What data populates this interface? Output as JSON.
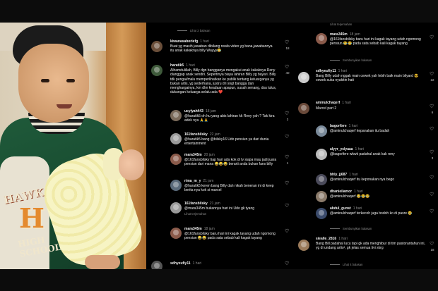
{
  "left_panel": {
    "replies_link": "Lihat 2 balasan",
    "see_translation": "Lihat terjemahan",
    "comments": [
      {
        "user": "kiwanasaboriefg",
        "time": "1 hari",
        "text": "Buat yg masih jawaban dibilang rwafa video yg bana,jawabannya itu anak kakaknya billy Wayyy😂",
        "likes": "18",
        "avatar_color": "#6b4f3a"
      },
      {
        "user": "haratik5",
        "time": "1 hari",
        "text": "Alhamdulillah, Billy dgn bangganya mengakui anak kakaknya Reny dianggap anak sendiri. Sepertinya biaya lahiran Billy yg bayari. Billy tdk pengai/malu memperlihatkan ke publik tentang keluarganya yg bukan artis, yg sederhana, justru dri sngt bangga dan menghargainya, km dlm keadaan apapun, susah senang, dsu tulus, dukungan keluarga selalu ada ❤️",
        "likes": "40",
        "avatar_color": "#3f5a3b"
      },
      {
        "user": "ucylyah443",
        "time": "18 jam",
        "text": "@haratik5 oh hu yang abis lahiran kk Reny yah ? Tak kira adek nya 🙏🙏",
        "likes": "3",
        "avatar_color": "#7a6a5a"
      },
      {
        "user": "161fansbilsky",
        "time": "22 jam",
        "text": "@haratik5 bang @bilsky16 Udo pensiun ya dari dunia entertainment",
        "likes": "",
        "avatar_color": "#9a9a9a"
      },
      {
        "user": "mara345m",
        "time": "20 jam",
        "text": "@161fansbilsky tiap hari ada kok di tv siapa mau jadi juara pensiun dari mana 😂😂😂 berarti anda bukan fans billy",
        "likes": "1",
        "avatar_color": "#8a5a4a"
      },
      {
        "user": "rima_m_y",
        "time": "21 jam",
        "text": "@haratik5 keren bang Billy dah nikah beneran ini di keep berita nya kok si marcel",
        "likes": "",
        "avatar_color": "#5a6a7a"
      },
      {
        "user": "161fansbilsky",
        "time": "21 jam",
        "text": "@mara345m bukannya hari ini Udo gk tyang",
        "likes": "",
        "avatar_color": "#9a9a9a"
      },
      {
        "user": "mara345m",
        "time": "18 jam",
        "text": "@161fansbilsky baru hari ini kagak tayang udah ngomong pensiun 😂😂 pada sata sebab kali kagak tayang",
        "likes": "",
        "avatar_color": "#8a5a4a"
      },
      {
        "user": "sdhyeufiy11",
        "time": "1 hari",
        "text": "",
        "likes": "",
        "avatar_color": "#555555"
      }
    ]
  },
  "right_panel": {
    "hide_replies": "Sembunyikan balasan",
    "see_translation": "Lihat terjemahan",
    "replies_link": "Lihat 4 balasan",
    "comments": [
      {
        "user": "mara345m",
        "time": "18 jam",
        "text": "@161fansbilsky baru hari ini kagak tayang udah ngomong pensiun 😂😂 pada sata sebab kali kagak tayang",
        "likes": "",
        "avatar_color": "#8a5a4a"
      },
      {
        "user": "sdhyeufiy11",
        "time": "1 hari",
        "text": "Bang Billy udah nggak main cewek yah lebih baik main bilyard 😎 cewek suka nyakitin hati",
        "likes": "22",
        "avatar_color": "#cccccc"
      },
      {
        "user": "aminulchaqerf",
        "time": "1 hari",
        "text": "Marcel part 2",
        "likes": "6",
        "avatar_color": "#6a4a3a"
      },
      {
        "user": "bagorltrre",
        "time": "1 hari",
        "text": "@aminulchaqerf kepanakan itu badah",
        "likes": "",
        "avatar_color": "#7a8a9a"
      },
      {
        "user": "alyyr_yslyaaa",
        "time": "1 hari",
        "text": "@bagorltrre wkwk padahal anak kak reny",
        "likes": "3",
        "avatar_color": "#bbbbbb"
      },
      {
        "user": "bhly_jj687",
        "time": "1 hari",
        "text": "@aminulchaqerf itu keponakan nya bego",
        "likes": "",
        "avatar_color": "#4a4a5a"
      },
      {
        "user": "dhanieilamor",
        "time": "1 hari",
        "text": "@aminulchaqerf 😂😂😂",
        "likes": "",
        "avatar_color": "#8a7a6a"
      },
      {
        "user": "abdul_gunst",
        "time": "1 hari",
        "text": "@aminulchaqerf terkecoh juga bodoh ko di pasre 😂",
        "likes": "",
        "avatar_color": "#3a4a6a"
      },
      {
        "user": "siealle_2816",
        "time": "1 hari",
        "text": "Bang Bill padahal lucu tapi gk ada menghibur di tim pastorantahun ini, yg di undang artis², gk jelas semua tivi skrg",
        "likes": "18",
        "avatar_color": "#9a7a5a"
      }
    ]
  }
}
